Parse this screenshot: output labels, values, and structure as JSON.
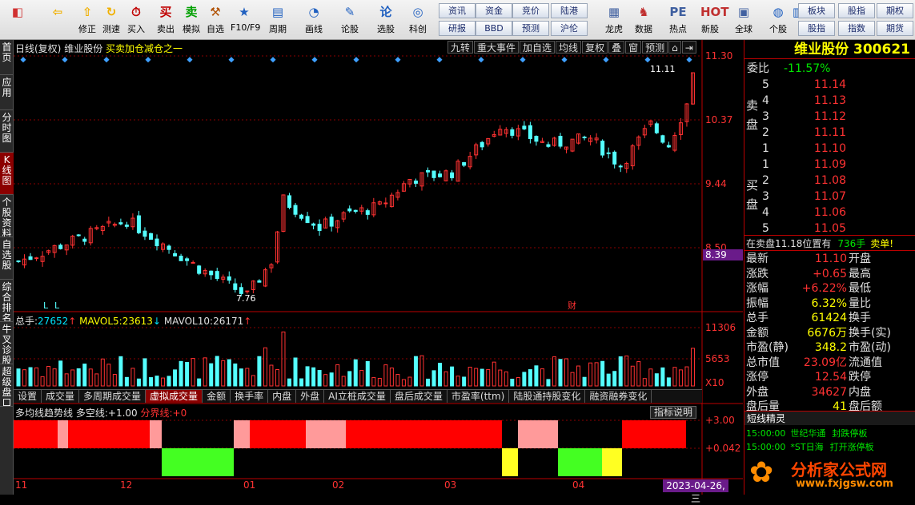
{
  "toolbar": {
    "buttons": [
      "",
      "",
      "修正",
      "测速",
      "买入",
      "卖出",
      "模拟",
      "自选",
      "F10/F9",
      "周期",
      "画线",
      "论股",
      "选股",
      "科创",
      "龙虎",
      "数据",
      "热点",
      "新股",
      "全球",
      "个股"
    ],
    "small": [
      "资讯",
      "资金",
      "竞价",
      "陆港",
      "研报",
      "BBD",
      "预测",
      "沪伦",
      "板块",
      "股指",
      "期权",
      "股指",
      "指数",
      "期货"
    ]
  },
  "sidebar": [
    "首页",
    "应用",
    "分时图",
    "K线图",
    "个股资料",
    "自选股",
    "综合排名",
    "牛叉诊股",
    "超级盘口"
  ],
  "chart": {
    "title": "日线(复权)",
    "stock": "维业股份",
    "signal": "买卖加仓减仓之一",
    "tabs": [
      "九转",
      "重大事件",
      "加自选",
      "均线",
      "复权",
      "叠",
      "窗",
      "预测"
    ],
    "price_ticks": [
      "11.30",
      "10.37",
      "9.44",
      "8.50"
    ],
    "last_box": "8.39",
    "high_label": "11.11",
    "low_label": "7.76",
    "markers": [
      "L",
      "L",
      "财"
    ],
    "vol_header": {
      "label": "总手:",
      "v": "27652",
      "m5l": "MAVOL5:",
      "m5": "23613",
      "m10l": "MAVOL10:",
      "m10": "26171"
    },
    "vol_ticks": [
      "11306",
      "5653"
    ],
    "x10": "X10",
    "vol_tabs": [
      "设置",
      "成交量",
      "多周期成交量",
      "虚拟成交量",
      "金额",
      "换手率",
      "内盘",
      "外盘",
      "AI立桩成交量",
      "盘后成交量",
      "市盈率(ttm)",
      "陆股通持股变化",
      "融资融券变化"
    ],
    "ind_header": {
      "name": "多均线趋势线",
      "d": "多空线:",
      "dv": "+1.00",
      "f": "分界线:",
      "fv": "+0"
    },
    "ind_btn": "指标说明",
    "ind_ticks": [
      "+3.00",
      "+0.042"
    ],
    "months": [
      "11",
      "12",
      "01",
      "02",
      "03",
      "04"
    ],
    "date": "2023-04-26,三"
  },
  "quote": {
    "name": "维业股份",
    "code": "300621",
    "wb_label": "委比",
    "wb": "-11.57%",
    "sell_label": "卖盘",
    "buy_label": "买盘",
    "asks": [
      [
        "5",
        "11.14"
      ],
      [
        "4",
        "11.13"
      ],
      [
        "3",
        "11.12"
      ],
      [
        "2",
        "11.11"
      ],
      [
        "1",
        "11.10"
      ]
    ],
    "bids": [
      [
        "1",
        "11.09"
      ],
      [
        "2",
        "11.08"
      ],
      [
        "3",
        "11.07"
      ],
      [
        "4",
        "11.06"
      ],
      [
        "5",
        "11.05"
      ]
    ],
    "note": "在卖盘11.18位置有",
    "note_v": "736手",
    "note_s": "卖单!",
    "stats": [
      [
        "最新",
        "11.10",
        "开盘",
        ""
      ],
      [
        "涨跌",
        "+0.65",
        "最高",
        ""
      ],
      [
        "涨幅",
        "+6.22%",
        "最低",
        ""
      ],
      [
        "振幅",
        "6.32%",
        "量比",
        ""
      ],
      [
        "总手",
        "61424",
        "换手",
        ""
      ],
      [
        "金额",
        "6676万",
        "换手(实)",
        ""
      ],
      [
        "市盈(静)",
        "348.2",
        "市盈(动)",
        ""
      ],
      [
        "总市值",
        "23.09亿",
        "流通值",
        ""
      ],
      [
        "涨停",
        "12.54",
        "跌停",
        ""
      ],
      [
        "外盘",
        "34627",
        "内盘",
        ""
      ],
      [
        "盘后量",
        "41",
        "盘后额",
        ""
      ]
    ],
    "news_title": "短线精灵",
    "news": [
      [
        "15:00:00",
        "世纪华通",
        "封跌停板"
      ],
      [
        "15:00:00",
        "*ST日海",
        "打开涨停板"
      ]
    ],
    "logo": "分析家公式网",
    "logo_url": "www.fxjgsw.com"
  }
}
